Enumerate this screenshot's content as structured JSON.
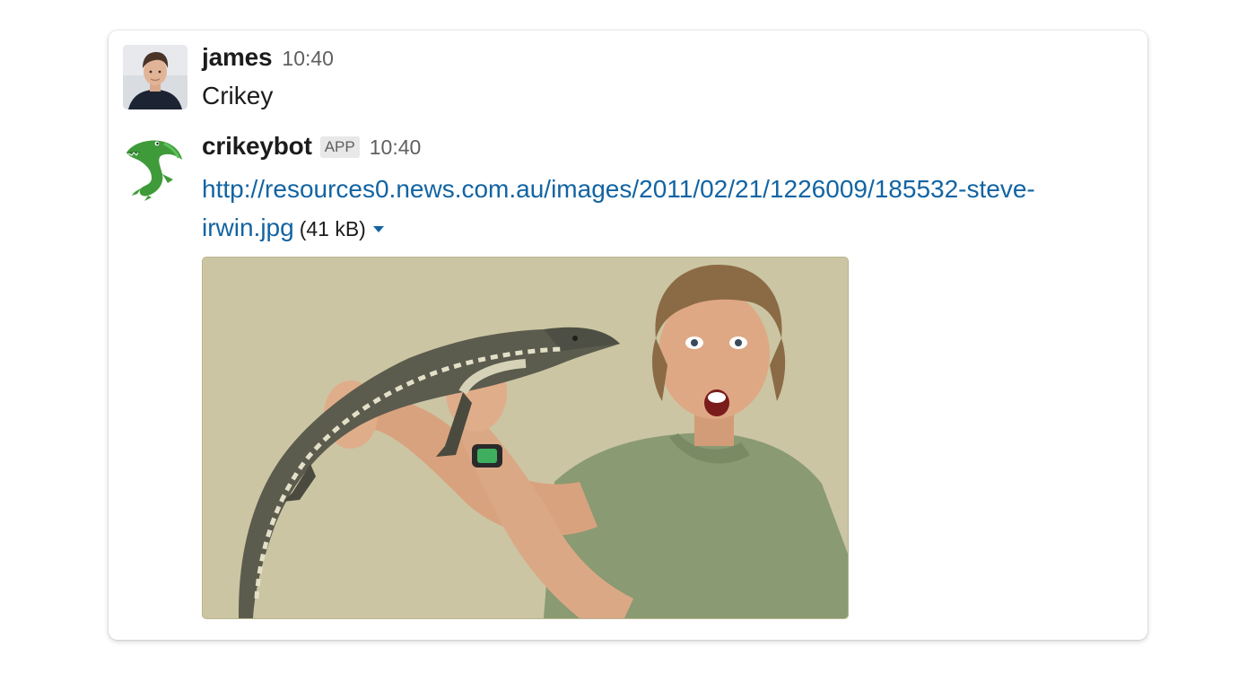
{
  "messages": [
    {
      "author": "james",
      "time": "10:40",
      "text": "Crikey",
      "avatar_icon": "user-photo"
    },
    {
      "author": "crikeybot",
      "badge": "APP",
      "time": "10:40",
      "link_text_1": "http://resources0.news.com.au/images/2011/02/21/1226009/185532-steve-",
      "link_text_2": "irwin.jpg",
      "link_href": "http://resources0.news.com.au/images/2011/02/21/1226009/185532-steve-irwin.jpg",
      "file_size": "(41 kB)",
      "avatar_icon": "crocodile",
      "image_icon": "man-holding-crocodile"
    }
  ],
  "colors": {
    "link": "#1264a3",
    "image_background": "#cbc5a3",
    "text": "#1d1c1d",
    "meta": "#616061"
  }
}
